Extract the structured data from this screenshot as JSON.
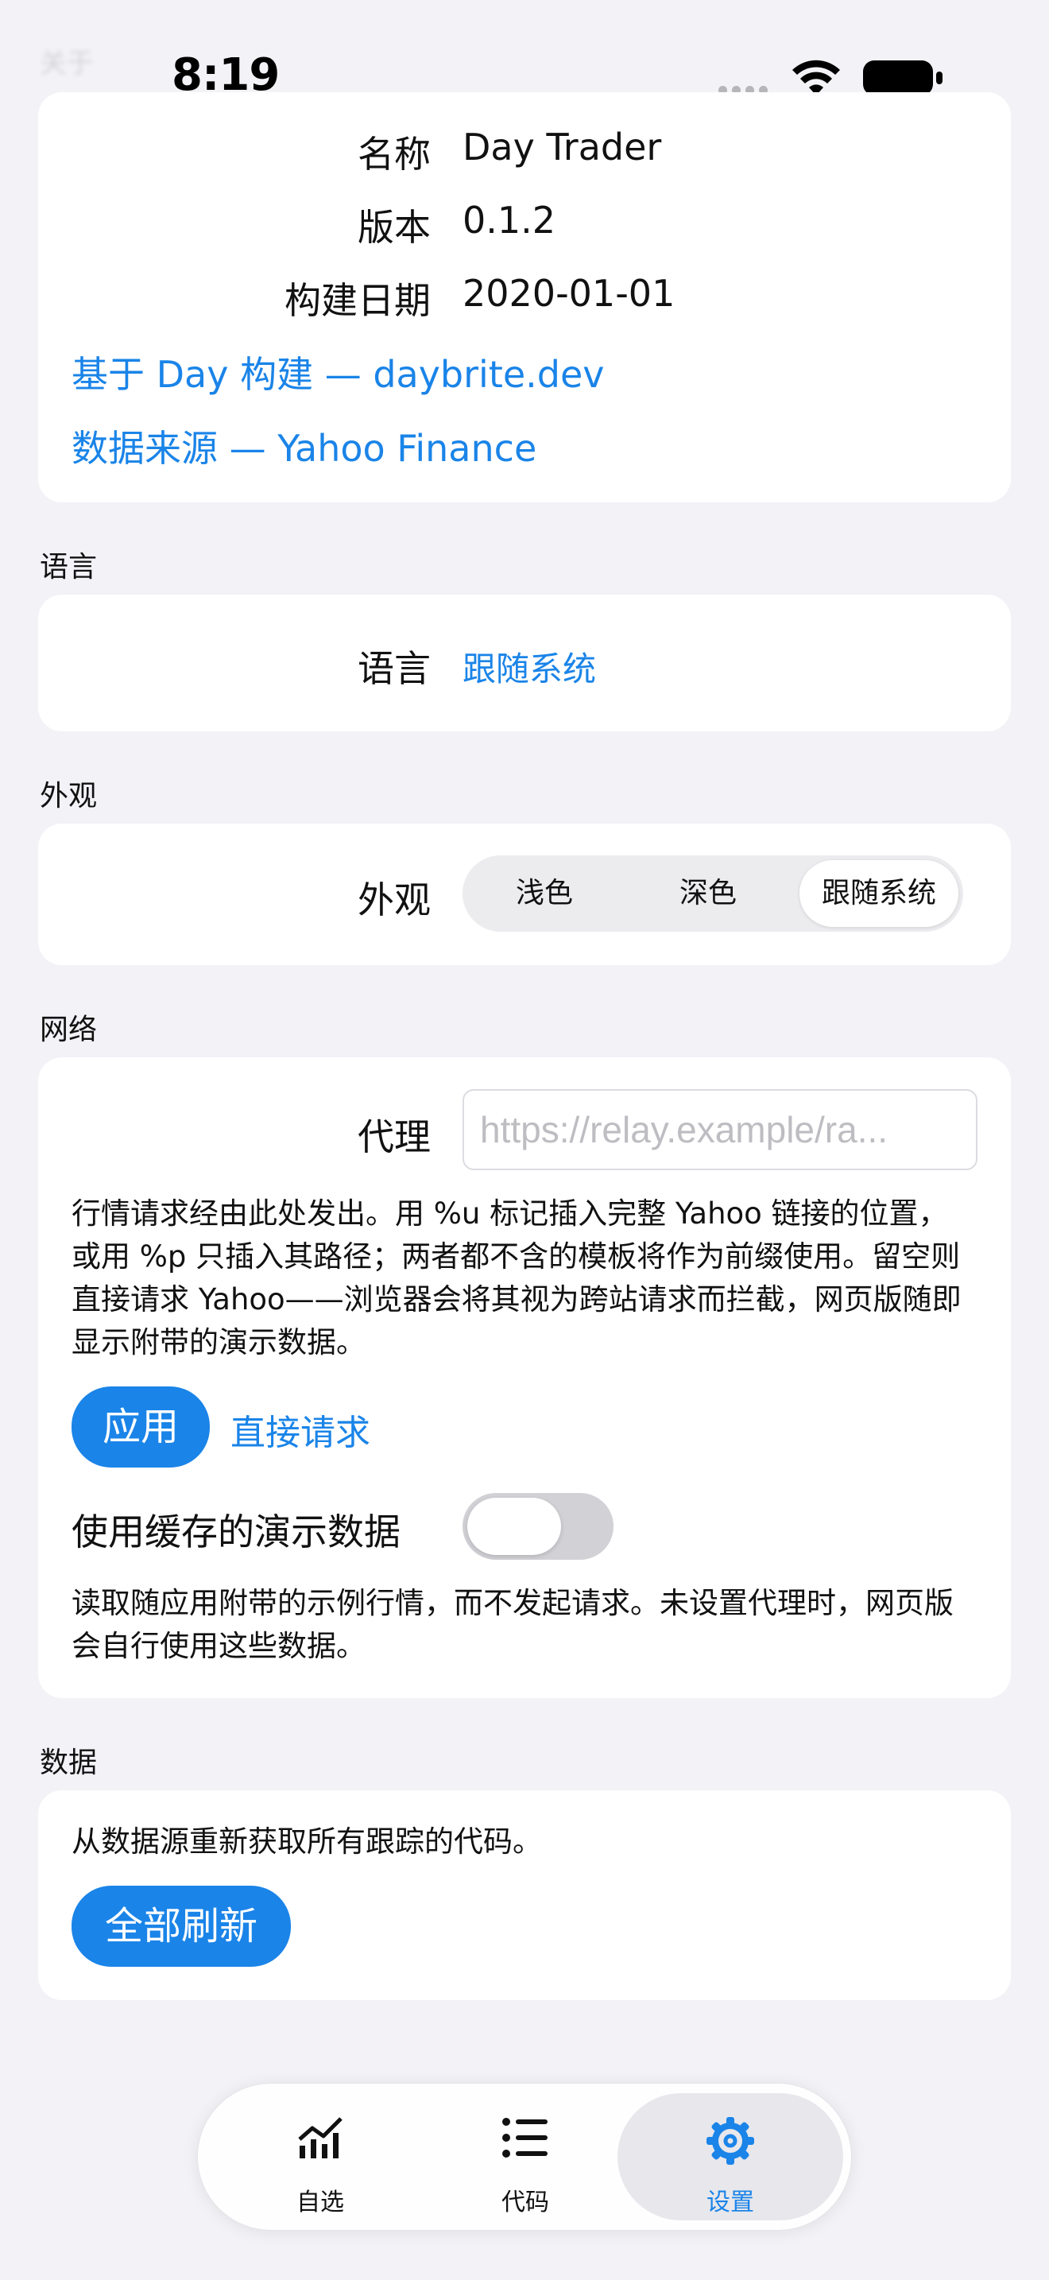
{
  "status_bar": {
    "ghost_title": "关于",
    "time": "8:19"
  },
  "about": {
    "rows": [
      {
        "label": "名称",
        "value": "Day Trader"
      },
      {
        "label": "版本",
        "value": "0.1.2"
      },
      {
        "label": "构建日期",
        "value": "2020-01-01"
      }
    ],
    "built_with_link": "基于 Day 构建 — daybrite.dev",
    "data_source_link": "数据来源 — Yahoo Finance"
  },
  "language": {
    "header": "语言",
    "label": "语言",
    "value": "跟随系统"
  },
  "appearance": {
    "header": "外观",
    "label": "外观",
    "options": [
      "浅色",
      "深色",
      "跟随系统"
    ],
    "selected": "跟随系统"
  },
  "network": {
    "header": "网络",
    "proxy_label": "代理",
    "proxy_placeholder": "https://relay.example/ra...",
    "proxy_value": "",
    "description": "行情请求经由此处发出。用 %u 标记插入完整 Yahoo 链接的位置，或用 %p 只插入其路径；两者都不含的模板将作为前缀使用。留空则直接请求 Yahoo——浏览器会将其视为跨站请求而拦截，网页版随即显示附带的演示数据。",
    "apply_label": "应用",
    "direct_label": "直接请求",
    "cached_demo_label": "使用缓存的演示数据",
    "cached_demo_enabled": false,
    "cached_demo_description": "读取随应用附带的示例行情，而不发起请求。未设置代理时，网页版会自行使用这些数据。"
  },
  "data_section": {
    "header": "数据",
    "description": "从数据源重新获取所有跟踪的代码。",
    "refresh_all_label": "全部刷新"
  },
  "tabbar": {
    "tabs": [
      {
        "label": "自选",
        "icon": "chart-line-icon"
      },
      {
        "label": "代码",
        "icon": "list-icon"
      },
      {
        "label": "设置",
        "icon": "gear-icon"
      }
    ],
    "active": "设置"
  },
  "colors": {
    "accent": "#1a84e8",
    "background": "#f2f2f7",
    "card": "#ffffff"
  }
}
